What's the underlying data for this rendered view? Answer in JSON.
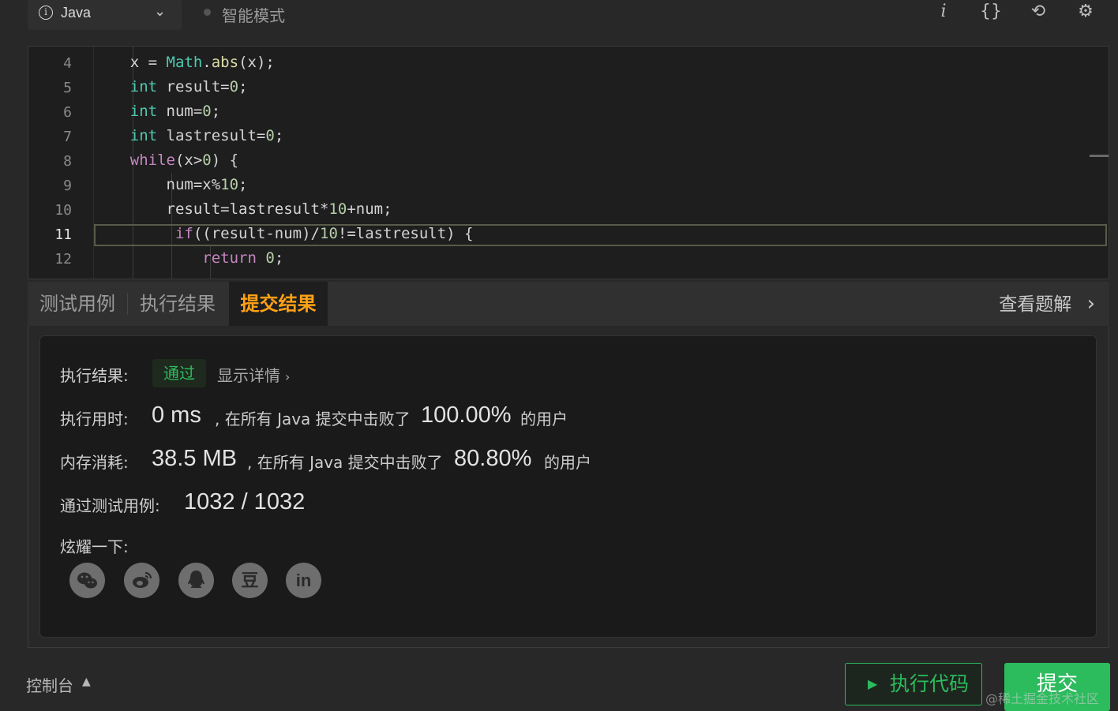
{
  "toolbar": {
    "language": "Java",
    "mode": "智能模式",
    "icons": [
      "info-icon",
      "braces-icon",
      "reset-icon",
      "settings-icon"
    ]
  },
  "editor": {
    "line_numbers": [
      "4",
      "5",
      "6",
      "7",
      "8",
      "9",
      "10",
      "11",
      "12"
    ],
    "active_line": "11"
  },
  "tabs": {
    "test_cases": "测试用例",
    "run_result": "执行结果",
    "submit_result": "提交结果",
    "view_solutions": "查看题解"
  },
  "result": {
    "status_label": "执行结果:",
    "status_value": "通过",
    "show_details": "显示详情",
    "runtime_label": "执行用时:",
    "runtime_value": "0 ms",
    "runtime_text": ", 在所有 Java 提交中击败了",
    "runtime_percent": "100.00%",
    "runtime_suffix": "的用户",
    "memory_label": "内存消耗:",
    "memory_value": "38.5 MB",
    "memory_text": ", 在所有 Java 提交中击败了",
    "memory_percent": "80.80%",
    "memory_suffix": "的用户",
    "cases_label": "通过测试用例:",
    "cases_value": "1032 / 1032",
    "share_label": "炫耀一下:",
    "share_icons": [
      "wechat-icon",
      "weibo-icon",
      "qq-icon",
      "douban-icon",
      "linkedin-icon"
    ],
    "douban_glyph": "豆",
    "linkedin_glyph": "in"
  },
  "footer": {
    "console": "控制台",
    "run_code": "执行代码",
    "submit": "提交",
    "watermark": "@稀土掘金技术社区"
  },
  "colors": {
    "accent_orange": "#ffa116",
    "accent_green": "#2cbb5d"
  }
}
